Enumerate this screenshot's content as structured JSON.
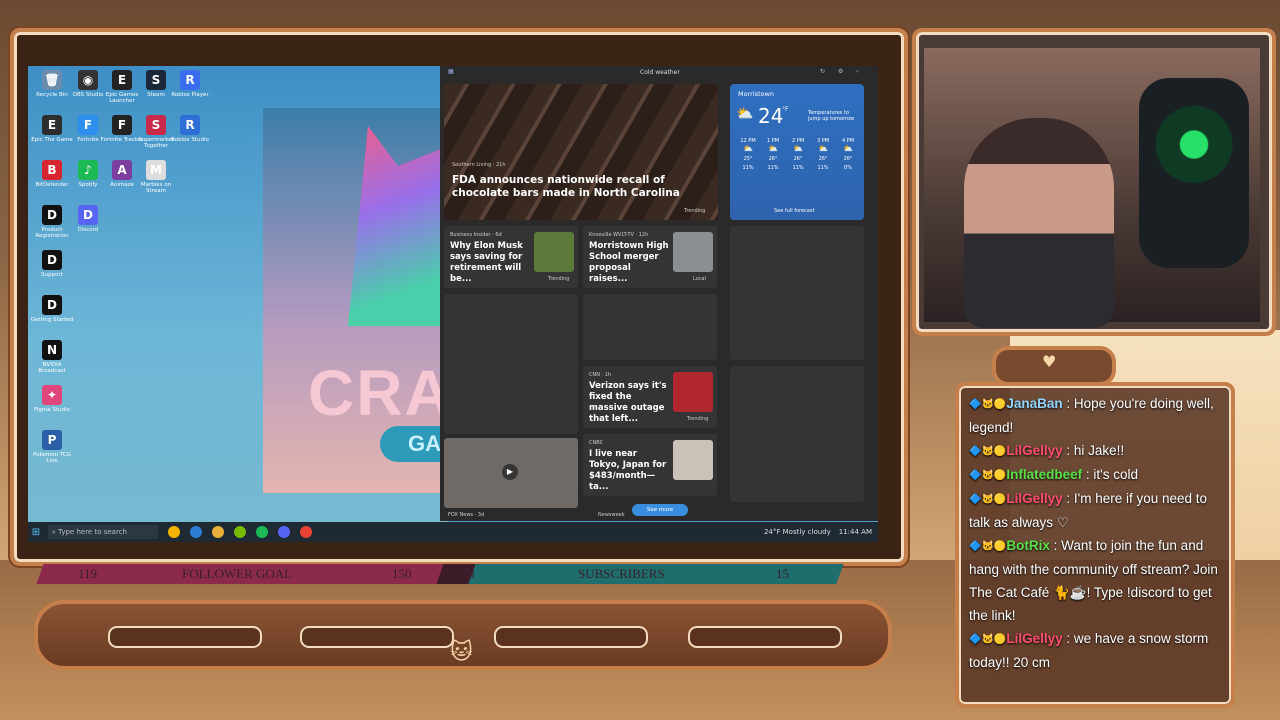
{
  "desktop": {
    "icons": [
      {
        "label": "Recycle Bin",
        "glyph": "🗑",
        "color": "#6a8caf"
      },
      {
        "label": "OBS Studio",
        "glyph": "◉",
        "color": "#333"
      },
      {
        "label": "Epic Games Launcher",
        "glyph": "E",
        "color": "#222"
      },
      {
        "label": "Steam",
        "glyph": "S",
        "color": "#1b2838"
      },
      {
        "label": "Roblox Player",
        "glyph": "R",
        "color": "#3a6df0"
      },
      {
        "label": "Epic The Game",
        "glyph": "E",
        "color": "#2d2d2d"
      },
      {
        "label": "Fortnite",
        "glyph": "F",
        "color": "#2f8ff0"
      },
      {
        "label": "Animaze",
        "glyph": "A",
        "color": "#7b3fa0"
      },
      {
        "label": "Roblox Studio",
        "glyph": "R",
        "color": "#2d6fd6"
      },
      {
        "label": "BitDefender",
        "glyph": "B",
        "color": "#d7262f"
      },
      {
        "label": "Spotify",
        "glyph": "♪",
        "color": "#1db954"
      },
      {
        "label": "Fortnite Tracker",
        "glyph": "F",
        "color": "#222"
      },
      {
        "label": "Supermarket Together",
        "glyph": "S",
        "color": "#c92a4a"
      },
      {
        "label": "Product Registration",
        "glyph": "D",
        "color": "#111"
      },
      {
        "label": "Discord",
        "glyph": "D",
        "color": "#5865f2"
      },
      {
        "label": "Marbles on Stream",
        "glyph": "M",
        "color": "#ddd"
      },
      {
        "label": "Support",
        "glyph": "D",
        "color": "#111"
      },
      {
        "label": "Getting Started",
        "glyph": "D",
        "color": "#111"
      },
      {
        "label": "NVIDIA Broadcast",
        "glyph": "N",
        "color": "#111"
      },
      {
        "label": "Figma Studio",
        "glyph": "✦",
        "color": "#e0457b"
      },
      {
        "label": "Pokemon TCG Live",
        "glyph": "P",
        "color": "#2a5fa8"
      }
    ],
    "promo_text": "CRAZ",
    "promo_sub": "GA"
  },
  "news": {
    "header_title": "Cold weather",
    "hero": {
      "source": "Southern Living · 21h",
      "title": "FDA announces nationwide recall of chocolate bars made in North Carolina",
      "tag": "Trending"
    },
    "weather": {
      "location": "Morristown",
      "temp": "24",
      "unit": "°F",
      "note": "Temperatures to jump up tomorrow",
      "hours": [
        {
          "t": "12 PM",
          "v": "25°",
          "p": "11%"
        },
        {
          "t": "1 PM",
          "v": "26°",
          "p": "11%"
        },
        {
          "t": "2 PM",
          "v": "26°",
          "p": "11%"
        },
        {
          "t": "3 PM",
          "v": "26°",
          "p": "11%"
        },
        {
          "t": "4 PM",
          "v": "26°",
          "p": "0%"
        }
      ],
      "link": "See full forecast"
    },
    "cards": [
      {
        "source": "Business Insider · 6d",
        "title": "Why Elon Musk says saving for retirement will be...",
        "tag": "Trending"
      },
      {
        "source": "Knoxville WVLT-TV · 12h",
        "title": "Morristown High School merger proposal raises...",
        "tag": "Local"
      },
      {
        "source": "CNN · 1h",
        "title": "Verizon says it's fixed the massive outage that left...",
        "tag": "Trending"
      },
      {
        "source": "CNBC",
        "title": "I live near Tokyo, Japan for $483/month—ta...",
        "tag": ""
      }
    ],
    "fox_source": "FOX News · 3d",
    "newsweek_source": "Newsweek",
    "see_more": "See more"
  },
  "taskbar": {
    "search_placeholder": "Type here to search",
    "weather": "24°F Mostly cloudy",
    "time": "11:44 AM"
  },
  "goals": {
    "follower_current": "119",
    "follower_label": "FOLLOWER GOAL",
    "follower_target": "150",
    "sub_current": "8",
    "sub_label": "SUBSCRIBERS",
    "sub_target": "15"
  },
  "chat": [
    {
      "user": "JanaBan",
      "color": "#8fd3ff",
      "text": ": Hope you're doing well, legend!"
    },
    {
      "user": "LilGellyy",
      "color": "#ff4f6e",
      "text": ": hi Jake!!"
    },
    {
      "user": "Inflatedbeef",
      "color": "#5be04a",
      "text": ": it's cold"
    },
    {
      "user": "LilGellyy",
      "color": "#ff4f6e",
      "text": ": I'm here if you need to talk as always ♡"
    },
    {
      "user": "BotRix",
      "color": "#5be04a",
      "text": ": Want to join the fun and hang with the community off stream? Join The Cat Café 🐈☕! Type !discord to get the link!"
    },
    {
      "user": "LilGellyy",
      "color": "#ff4f6e",
      "text": ": we have a snow storm today!! 20 cm"
    }
  ]
}
